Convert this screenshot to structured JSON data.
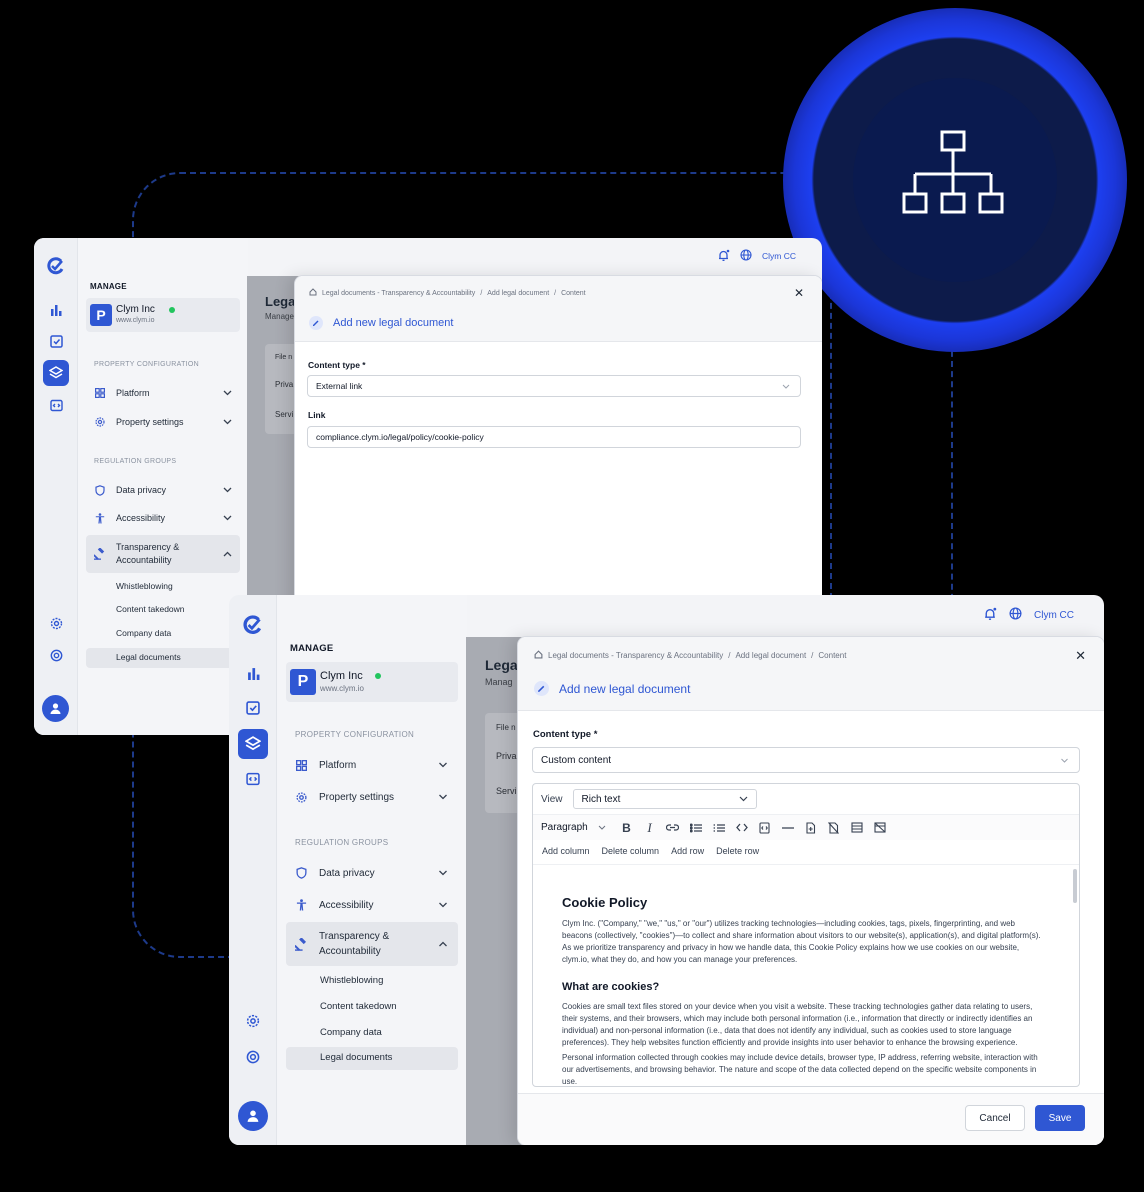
{
  "brand": {
    "accent": "#2f57d3",
    "status_online": "#22c55e"
  },
  "decor": {
    "network_icon": "network-hierarchy-icon"
  },
  "back_window": {
    "user_label": "Clym CC",
    "manage_label": "MANAGE",
    "org": {
      "logo_letter": "P",
      "name": "Clym Inc",
      "url": "www.clym.io"
    },
    "sections": {
      "property": "PROPERTY CONFIGURATION",
      "regulation": "REGULATION GROUPS"
    },
    "nav": {
      "platform": "Platform",
      "property_settings": "Property settings",
      "data_privacy": "Data privacy",
      "accessibility": "Accessibility",
      "transparency_line1": "Transparency &",
      "transparency_line2": "Accountability"
    },
    "sub": [
      "Whistleblowing",
      "Content takedown",
      "Company data",
      "Legal documents"
    ],
    "page": {
      "title": "Lega",
      "subtitle": "Manage",
      "col": "File n",
      "row1": "Priva",
      "row2": "Servi"
    },
    "modal": {
      "breadcrumb": [
        "Legal documents - Transparency & Accountability",
        "Add legal document",
        "Content"
      ],
      "title": "Add new legal document",
      "content_type_label": "Content type *",
      "content_type_value": "External link",
      "link_label": "Link",
      "link_value": "compliance.clym.io/legal/policy/cookie-policy"
    }
  },
  "front_window": {
    "user_label": "Clym CC",
    "manage_label": "MANAGE",
    "org": {
      "logo_letter": "P",
      "name": "Clym Inc",
      "url": "www.clym.io"
    },
    "sections": {
      "property": "PROPERTY CONFIGURATION",
      "regulation": "REGULATION GROUPS"
    },
    "nav": {
      "platform": "Platform",
      "property_settings": "Property settings",
      "data_privacy": "Data privacy",
      "accessibility": "Accessibility",
      "transparency_line1": "Transparency &",
      "transparency_line2": "Accountability"
    },
    "sub": [
      "Whistleblowing",
      "Content takedown",
      "Company data",
      "Legal documents"
    ],
    "page": {
      "title": "Lega",
      "subtitle": "Manag",
      "col": "File n",
      "row1": "Priva",
      "row2": "Servi"
    },
    "modal": {
      "breadcrumb": [
        "Legal documents - Transparency & Accountability",
        "Add legal document",
        "Content"
      ],
      "title": "Add new legal document",
      "content_type_label": "Content type *",
      "content_type_value": "Custom content",
      "view_label": "View",
      "view_value": "Rich text",
      "block_format": "Paragraph",
      "table_actions": [
        "Add column",
        "Delete column",
        "Add row",
        "Delete row"
      ],
      "doc": {
        "h1": "Cookie Policy",
        "p1": "Clym Inc. (\"Company,\" \"we,\" \"us,\" or \"our\") utilizes tracking technologies—including cookies, tags, pixels, fingerprinting, and web beacons (collectively, \"cookies\")—to collect and share information about visitors to our website(s), application(s), and digital platform(s). As we prioritize transparency and privacy in how we handle data, this Cookie Policy explains how we use cookies on our website, clym.io, what they do, and how you can manage your preferences.",
        "h2": "What are cookies?",
        "p2": "Cookies are small text files stored on your device when you visit a website. These tracking technologies gather data relating to users, their systems, and their browsers, which may include both personal information (i.e., information that directly or indirectly identifies an individual) and non-personal information (i.e., data that does not identify any individual, such as cookies used to store language preferences). They help websites function efficiently and provide insights into user behavior to enhance the browsing experience.",
        "p3": "Personal information collected through cookies may include device details, browser type, IP address, referring website, interaction with our advertisements, and browsing behavior. The nature and scope of the data collected depend on the specific website components in use."
      },
      "cancel": "Cancel",
      "save": "Save"
    }
  }
}
